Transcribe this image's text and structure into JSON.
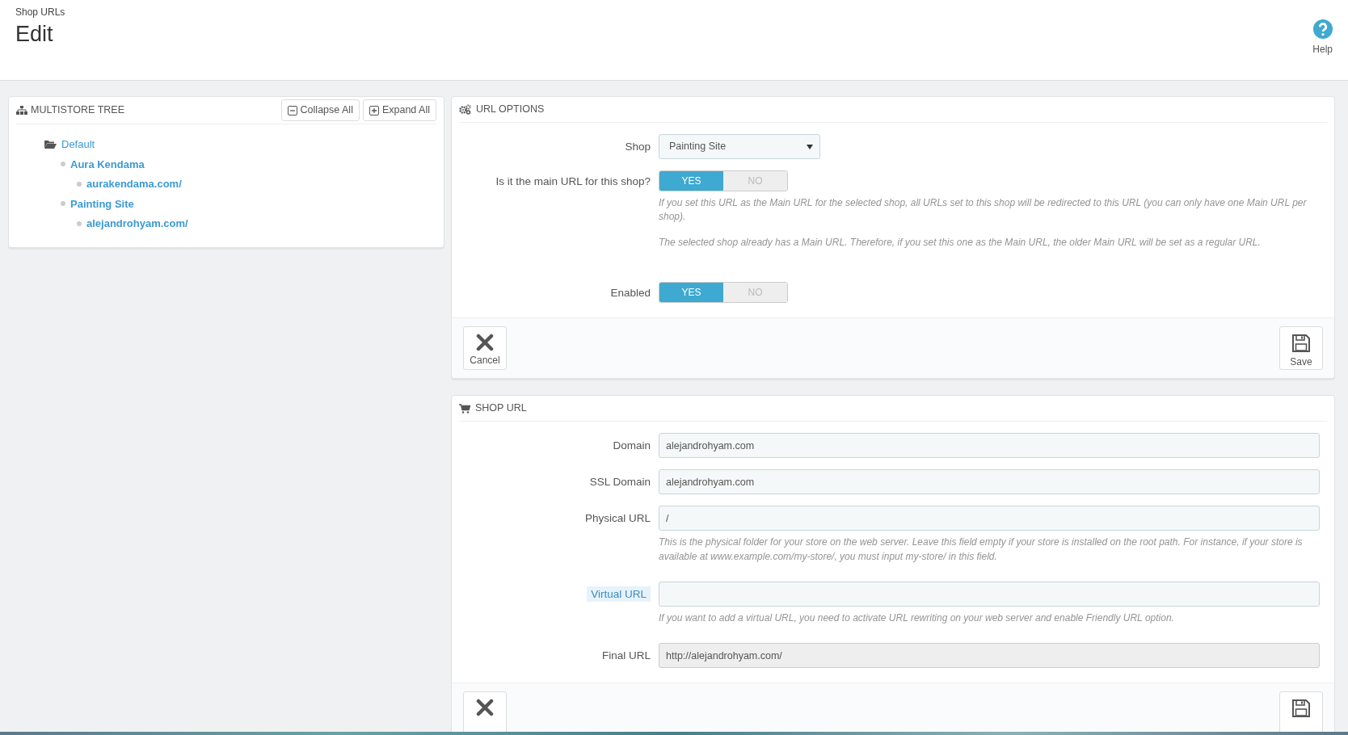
{
  "page": {
    "breadcrumb": "Shop URLs",
    "title": "Edit",
    "help": "Help"
  },
  "tree_panel": {
    "title": "MULTISTORE TREE",
    "buttons": [
      {
        "kind": "collapse",
        "label": "Collapse All"
      },
      {
        "kind": "expand",
        "label": "Expand All"
      }
    ],
    "tree": [
      {
        "label": "Default",
        "children": [
          {
            "label": "Aura Kendama",
            "children": [
              {
                "label": "aurakendama.com/"
              }
            ]
          },
          {
            "label": "Painting Site",
            "children": [
              {
                "label": "alejandrohyam.com/"
              }
            ]
          }
        ]
      }
    ]
  },
  "url_options": {
    "title": "URL OPTIONS",
    "fields": [
      {
        "kind": "select",
        "label": "Shop",
        "value": "Painting Site"
      },
      {
        "kind": "switch",
        "label": "Is it the main URL for this shop?",
        "options": [
          {
            "label": "YES",
            "selected": true
          },
          {
            "label": "NO",
            "selected": false
          }
        ],
        "help": [
          "If you set this URL as the Main URL for the selected shop, all URLs set to this shop will be redirected to this URL (you can only have one Main URL per shop).",
          "The selected shop already has a Main URL. Therefore, if you set this one as the Main URL, the older Main URL will be set as a regular URL."
        ]
      },
      {
        "kind": "switch",
        "label": "Enabled",
        "options": [
          {
            "label": "YES",
            "selected": true
          },
          {
            "label": "NO",
            "selected": false
          }
        ]
      }
    ],
    "buttons": [
      {
        "kind": "cancel",
        "label": "Cancel"
      },
      {
        "kind": "save",
        "label": "Save"
      }
    ]
  },
  "shop_url": {
    "title": "SHOP URL",
    "fields": [
      {
        "kind": "text",
        "label": "Domain",
        "value": "alejandrohyam.com"
      },
      {
        "kind": "text",
        "label": "SSL Domain",
        "value": "alejandrohyam.com"
      },
      {
        "kind": "text",
        "label": "Physical URL",
        "value": "/",
        "help": [
          "This is the physical folder for your store on the web server. Leave this field empty if your store is installed on the root path. For instance, if your store is available at www.example.com/my-store/, you must input my-store/ in this field."
        ]
      },
      {
        "kind": "text",
        "label": "Virtual URL",
        "highlighted": true,
        "help": [
          "If you want to add a virtual URL, you need to activate URL rewriting on your web server and enable Friendly URL option."
        ]
      },
      {
        "kind": "readonly",
        "label": "Final URL",
        "value": "http://alejandrohyam.com/"
      }
    ],
    "buttons": [
      {
        "kind": "cancel"
      },
      {
        "kind": "save"
      }
    ]
  }
}
